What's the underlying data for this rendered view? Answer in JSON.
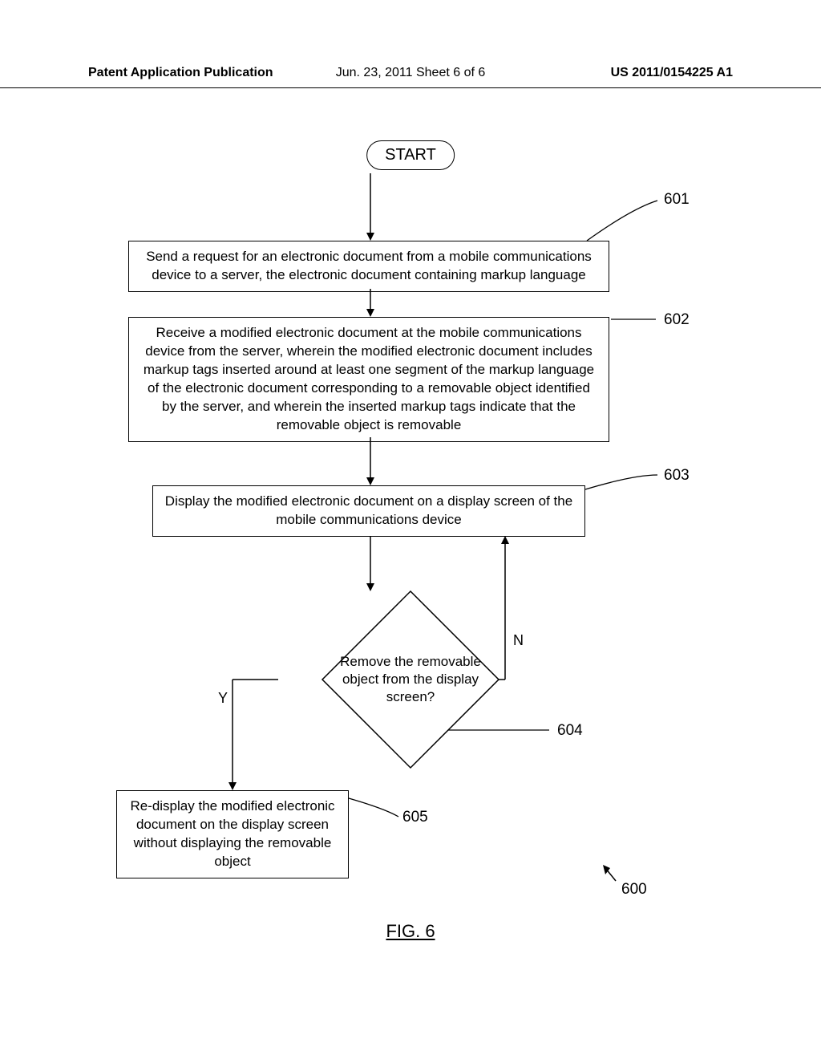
{
  "header": {
    "left": "Patent Application Publication",
    "mid": "Jun. 23, 2011  Sheet 6 of 6",
    "right": "US 2011/0154225 A1"
  },
  "flow": {
    "start": "START",
    "step601": "Send a request for an electronic document from a mobile communications device to a server, the electronic document containing markup language",
    "step602": "Receive a modified electronic document at the mobile communications device from the server, wherein the modified electronic document includes markup tags inserted around at least one segment of the markup language of the electronic document corresponding to a removable object identified by the server, and wherein the inserted markup tags indicate that the removable object is removable",
    "step603": "Display the modified electronic document on a display screen of the mobile communications device",
    "decision604": "Remove the removable object from the display screen?",
    "step605": "Re-display the modified electronic document on the display screen without displaying the removable object",
    "yes": "Y",
    "no": "N"
  },
  "refs": {
    "r601": "601",
    "r602": "602",
    "r603": "603",
    "r604": "604",
    "r605": "605",
    "r600": "600"
  },
  "figure": "FIG. 6"
}
